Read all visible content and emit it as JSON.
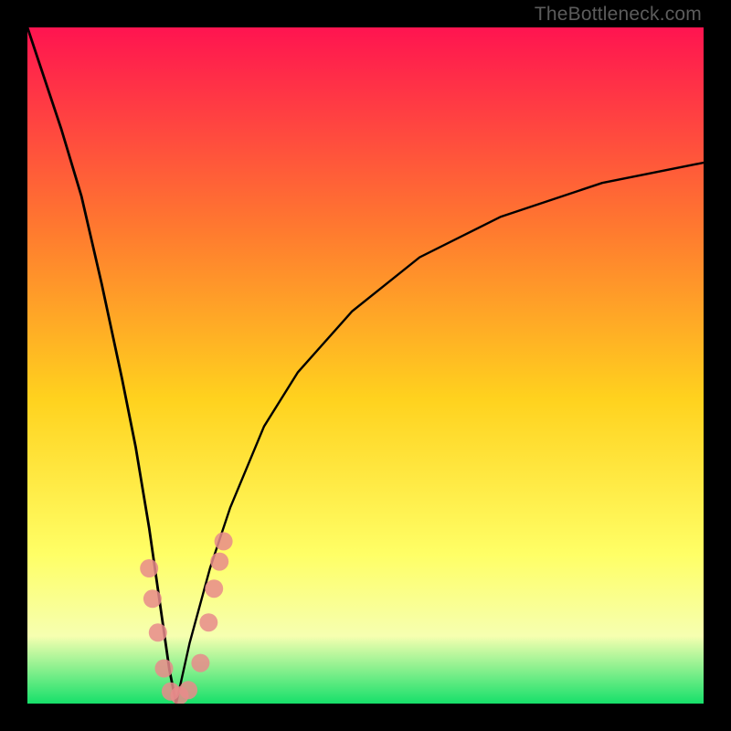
{
  "watermark": "TheBottleneck.com",
  "colors": {
    "top": "#ff1450",
    "mid1": "#ff7a2f",
    "mid2": "#ffd21e",
    "mid3": "#ffff66",
    "mid4": "#f6ffb0",
    "bottom": "#16e06a",
    "curve": "#000000",
    "marker": "#e78b8b",
    "frame": "#000000"
  },
  "chart_data": {
    "type": "line",
    "title": "",
    "xlabel": "",
    "ylabel": "",
    "xlim": [
      0,
      100
    ],
    "ylim": [
      0,
      100
    ],
    "notch_x": 22,
    "curve_description": "V-shaped bottleneck curve dipping to y≈0 at x≈22; steep left arm rising to top-left corner, right arm rising asymptotically toward ~80% height at right edge.",
    "series": [
      {
        "name": "left-arm",
        "x": [
          0,
          2,
          5,
          8,
          11,
          14,
          16,
          18,
          20,
          21,
          22
        ],
        "y": [
          100,
          94,
          85,
          75,
          62,
          48,
          38,
          26,
          12,
          5,
          0
        ]
      },
      {
        "name": "right-arm",
        "x": [
          22,
          24,
          27,
          30,
          35,
          40,
          48,
          58,
          70,
          85,
          100
        ],
        "y": [
          0,
          9,
          20,
          29,
          41,
          49,
          58,
          66,
          72,
          77,
          80
        ]
      }
    ],
    "markers": {
      "name": "highlighted-points",
      "color": "#e78b8b",
      "points": [
        {
          "x": 18.0,
          "y": 20.0
        },
        {
          "x": 18.5,
          "y": 15.5
        },
        {
          "x": 19.3,
          "y": 10.5
        },
        {
          "x": 20.2,
          "y": 5.2
        },
        {
          "x": 21.2,
          "y": 1.8
        },
        {
          "x": 22.5,
          "y": 1.2
        },
        {
          "x": 23.8,
          "y": 2.0
        },
        {
          "x": 25.6,
          "y": 6.0
        },
        {
          "x": 26.8,
          "y": 12.0
        },
        {
          "x": 27.6,
          "y": 17.0
        },
        {
          "x": 28.4,
          "y": 21.0
        },
        {
          "x": 29.0,
          "y": 24.0
        }
      ]
    }
  }
}
